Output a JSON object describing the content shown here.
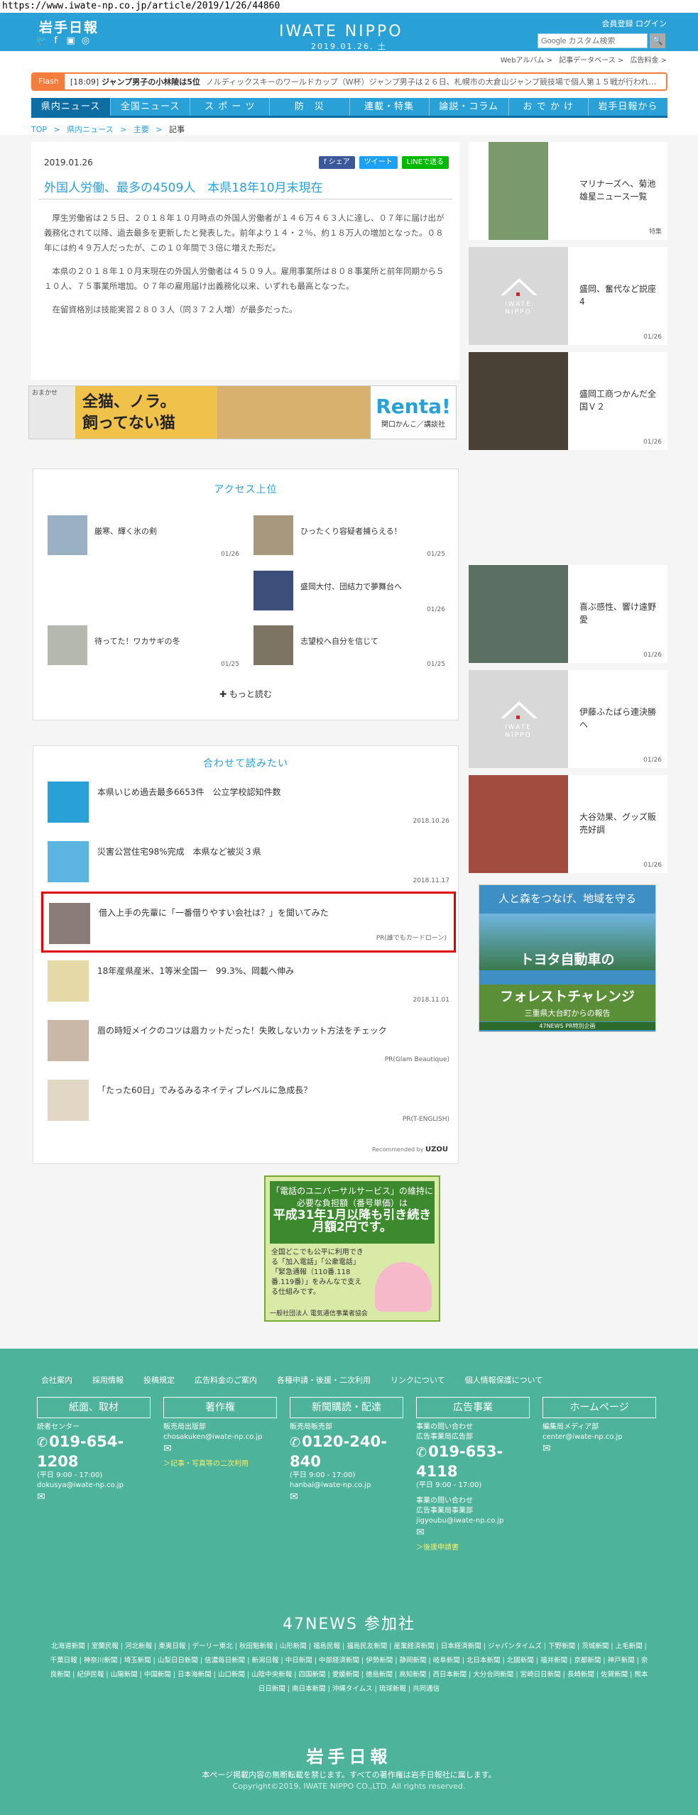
{
  "browser": {
    "url": "https://www.iwate-np.co.jp/article/2019/1/26/44860"
  },
  "header": {
    "logo_jp": "岩手日報",
    "brand": "IWATE NIPPO",
    "date": "2019.01.26. 土",
    "member_link": "会員登録 ログイン",
    "search_placeholder": "Google カスタム検索",
    "search_button": "🔍",
    "social": [
      "twitter-icon",
      "facebook-icon",
      "line-icon",
      "instagram-icon"
    ]
  },
  "subnav": {
    "items": [
      "Webアルバム >",
      "記事データベース >",
      "広告料金 >"
    ]
  },
  "flash": {
    "tag": "Flash",
    "time": "[18:09]",
    "headline": "ジャンプ男子の小林陵は5位",
    "body": "ノルディックスキーのワールドカップ（W杯）ジャンプ男子は２６日、札幌市の大倉山ジャンプ競技場で個人第１５戦が行われ…"
  },
  "gnav": {
    "items": [
      "県内ニュース",
      "全国ニュース",
      "ス ポ ー ツ",
      "防　災",
      "連載・特集",
      "論説・コラム",
      "お で か け",
      "岩手日報から"
    ]
  },
  "breadcrumb": {
    "items": [
      "TOP",
      ">",
      "県内ニュース",
      ">",
      "主要",
      ">",
      "記事"
    ]
  },
  "article": {
    "date": "2019.01.26",
    "share": {
      "fb": "f シェア",
      "tw": "ツイート",
      "line": "LINEで送る"
    },
    "title": "外国人労働、最多の4509人　本県18年10月末現在",
    "paragraphs": [
      "厚生労働省は２５日、２０１８年１０月時点の外国人労働者が１４６万４６３人に達し、０７年に届け出が義務化されて以降、過去最多を更新したと発表した。前年より１４・２％、約１８万人の増加となった。０８年には約４９万人だったが、この１０年間で３倍に増えた形だ。",
      "本県の２０１８年１０月末現在の外国人労働者は４５０９人。雇用事業所は８０８事業所と前年同期から５１０人、７５事業所増加。０７年の雇用届け出義務化以来、いずれも最高となった。",
      "在留資格別は技能実習２８０３人（同３７２人増）が最多だった。"
    ]
  },
  "ad_banner": {
    "side_text": "おまかせ",
    "headline_1": "全猫、ノラ。",
    "headline_2": "飼ってない猫",
    "brand": "Renta!",
    "credit": "関口かんこ／講談社"
  },
  "access": {
    "title": "アクセス上位",
    "items": [
      {
        "title": "厳寒、輝く氷の剣",
        "date": "01/26"
      },
      {
        "title": "ひったくり容疑者捕らえる！",
        "date": "01/25"
      },
      {
        "title": "盛岡大付、団結力で夢舞台へ",
        "date": "01/26"
      },
      {
        "title": "待ってた！ワカサギの冬",
        "date": "01/25"
      },
      {
        "title": "志望校へ自分を信じて",
        "date": "01/25"
      }
    ],
    "more": "✚ もっと読む"
  },
  "related": {
    "title": "合わせて読みたい",
    "items": [
      {
        "title": "本県いじめ過去最多6653件　公立学校認知件数",
        "date": "2018.10.26"
      },
      {
        "title": "災害公営住宅98%完成　本県など被災３県",
        "date": "2018.11.17"
      },
      {
        "title": "借入上手の先輩に「一番借りやすい会社は？」を聞いてみた",
        "date": "PR(誰でもカードローン)"
      },
      {
        "title": "18年産県産米、1等米全国一　99.3%、岡載へ伸み",
        "date": "2018.11.01"
      },
      {
        "title": "眉の時短メイクのコツは眉カットだった！失敗しないカット方法をチェック",
        "date": "PR(Glam Beautique)"
      },
      {
        "title": "「たった60日」でみるみるネイティブレベルに急成長？",
        "date": "PR(T-ENGLISH)"
      }
    ],
    "recommended": "Recommended by",
    "recommended_brand": "UZOU"
  },
  "sidebar": {
    "items": [
      {
        "title": "マリナーズへ、菊池雄星ニュース一覧",
        "date": "特集"
      },
      {
        "title": "盛岡、奮代など説座4",
        "date": "01/26"
      },
      {
        "title": "盛岡工商つかんだ全国Ｖ２",
        "date": "01/26"
      },
      {
        "title": "喜ぶ感性、響け遠野愛",
        "date": "01/26"
      },
      {
        "title": "伊藤ふたばら連決勝へ",
        "date": "01/26"
      },
      {
        "title": "大谷効果、グッズ販売好調",
        "date": "01/26"
      }
    ],
    "placeholder_brand": "IWATE\nNIPPO"
  },
  "toyota_ad": {
    "line1": "人と森をつなげ、地域を守る",
    "line2": "トヨタ自動車の",
    "line3": "フォレストチャレンジ",
    "line4": "三重県大台町からの報告",
    "line5": "47NEWS PR特別企画"
  },
  "uni_ad": {
    "head": "「電話のユニバーサルサービス」の維持に必要な負担額（番号単価）は",
    "big": "平成31年1月以降も引き続き月額2円です。",
    "body": "全国どこでも公平に利用できる「加入電話」「公衆電話」「緊急通報（110番.118番.119番）」をみんなで支える仕組みです。",
    "org": "一般社団法人 電気通信事業者協会"
  },
  "footer": {
    "links": [
      "会社案内",
      "採用情報",
      "投稿規定",
      "広告料金のご案内",
      "各種申請・後援・二次利用",
      "リンクについて",
      "個人情報保護について"
    ],
    "cols": [
      {
        "head": "紙面、取材",
        "lines": [
          "読者センター"
        ],
        "tel": "019-654-1208",
        "hours": "(平日 9:00 - 17:00)",
        "email": "dokusya@iwate-np.co.jp"
      },
      {
        "head": "著作権",
        "lines": [
          "販売局出版部"
        ],
        "email_top": "chosakuken@iwate-np.co.jp",
        "link": "＞記事・写真等の二次利用"
      },
      {
        "head": "新聞購読・配達",
        "lines": [
          "販売局販売部"
        ],
        "tel": "0120-240-840",
        "hours": "(平日 9:00 - 17:00)",
        "email": "hanbai@iwate-np.co.jp"
      },
      {
        "head": "広告事業",
        "lines": [
          "事業の問い合わせ",
          "広告事業局広告部"
        ],
        "tel": "019-653-4118",
        "hours": "(平日 9:00 - 17:00)",
        "lines2": [
          "事業の問い合わせ",
          "広告事業局事業部"
        ],
        "email": "jigyoubu@iwate-np.co.jp",
        "link": "＞後援申請書"
      },
      {
        "head": "ホームページ",
        "lines": [
          "編集局メディア部"
        ],
        "email_top": "center@iwate-np.co.jp"
      }
    ],
    "n47_title": "47NEWS 参加社",
    "n47_members": [
      "北海道新聞",
      "室蘭民報",
      "河北新報",
      "東奥日報",
      "デーリー東北",
      "秋田魁新報",
      "山形新聞",
      "福島民報",
      "福島民友新聞",
      "産業経済新聞",
      "日本経済新聞",
      "ジャパンタイムズ",
      "下野新聞",
      "茨城新聞",
      "上毛新聞",
      "千葉日報",
      "神奈川新聞",
      "埼玉新聞",
      "山梨日日新聞",
      "信濃毎日新聞",
      "新潟日報",
      "中日新聞",
      "中部経済新聞",
      "伊勢新聞",
      "静岡新聞",
      "岐阜新聞",
      "北日本新聞",
      "北國新聞",
      "福井新聞",
      "京都新聞",
      "神戸新聞",
      "奈良新聞",
      "紀伊民報",
      "山陽新聞",
      "中国新聞",
      "日本海新聞",
      "山口新聞",
      "山陰中央新報",
      "四国新聞",
      "愛媛新聞",
      "徳島新聞",
      "高知新聞",
      "西日本新聞",
      "大分合同新聞",
      "宮崎日日新聞",
      "長崎新聞",
      "佐賀新聞",
      "熊本日日新聞",
      "南日本新聞",
      "沖縄タイムス",
      "琉球新報",
      "共同通信"
    ],
    "logo": "岩手日報",
    "note": "本ページ掲載内容の無断転載を禁じます。すべての著作権は岩手日報社に属します。",
    "copyright": "Copyright©2019, IWATE NIPPO CO.,LTD. All rights reserved."
  }
}
